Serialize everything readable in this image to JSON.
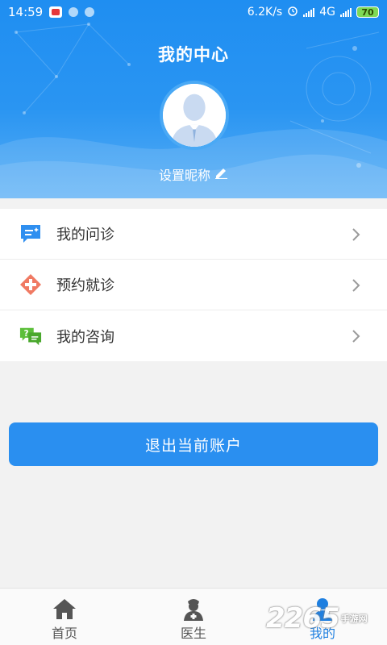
{
  "status_bar": {
    "time": "14:59",
    "speed": "6.2K/s",
    "network": "4G",
    "battery": "70"
  },
  "header": {
    "title": "我的中心",
    "nickname_label": "设置昵称"
  },
  "menu": {
    "items": [
      {
        "label": "我的问诊",
        "icon": "chat-list-icon",
        "color": "#2f8ff0"
      },
      {
        "label": "预约就诊",
        "icon": "medical-cross-icon",
        "color": "#f07a63"
      },
      {
        "label": "我的咨询",
        "icon": "question-bubble-icon",
        "color": "#5cbf3a"
      }
    ]
  },
  "logout_label": "退出当前账户",
  "tabbar": {
    "items": [
      {
        "label": "首页",
        "icon": "home-icon"
      },
      {
        "label": "医生",
        "icon": "doctor-icon"
      },
      {
        "label": "我的",
        "icon": "user-icon",
        "active": true
      }
    ]
  },
  "watermark": {
    "brand": "2265",
    "sub": "手游网"
  },
  "colors": {
    "accent": "#2a8ff0",
    "header_top": "#1f8ef1",
    "active_tab": "#1e7fe0"
  }
}
